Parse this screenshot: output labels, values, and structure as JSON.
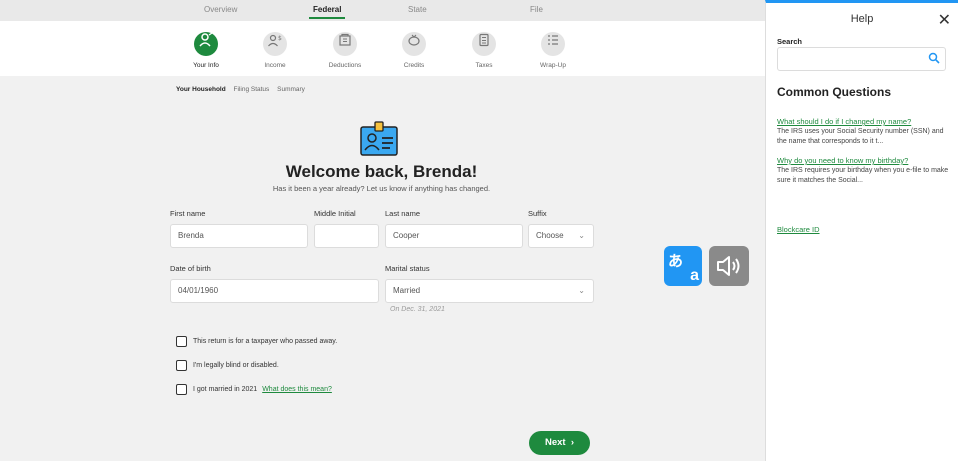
{
  "top_tabs": [
    {
      "label": "Overview"
    },
    {
      "label": "Federal"
    },
    {
      "label": "State"
    },
    {
      "label": "File"
    }
  ],
  "steps": [
    {
      "label": "Your Info",
      "icon": "person-icon"
    },
    {
      "label": "Income",
      "icon": "income-icon"
    },
    {
      "label": "Deductions",
      "icon": "deductions-icon"
    },
    {
      "label": "Credits",
      "icon": "piggy-bank-icon"
    },
    {
      "label": "Taxes",
      "icon": "calculator-icon"
    },
    {
      "label": "Wrap-Up",
      "icon": "checklist-icon"
    }
  ],
  "sub_nav": [
    "Your Household",
    "Filing Status",
    "Summary"
  ],
  "header": {
    "title": "Welcome back, Brenda!",
    "subtitle": "Has it been a year already? Let us know if anything has changed."
  },
  "form": {
    "first_name": {
      "label": "First name",
      "value": "Brenda"
    },
    "middle_initial": {
      "label": "Middle Initial",
      "value": ""
    },
    "last_name": {
      "label": "Last name",
      "value": "Cooper"
    },
    "suffix": {
      "label": "Suffix",
      "value": "Choose"
    },
    "dob": {
      "label": "Date of birth",
      "value": "04/01/1960"
    },
    "marital_status": {
      "label": "Marital status",
      "value": "Married",
      "note": "On Dec. 31, 2021"
    },
    "checkboxes": [
      {
        "label": "This return is for a taxpayer who passed away.",
        "checked": false
      },
      {
        "label": "I'm legally blind or disabled.",
        "checked": false
      },
      {
        "label": "I got married in 2021",
        "checked": false,
        "link": "What does this mean?"
      }
    ],
    "next_label": "Next"
  },
  "help": {
    "title": "Help",
    "close": "✕",
    "search_label": "Search",
    "search_placeholder": "",
    "heading": "Common Questions",
    "questions": [
      {
        "q": "What should I do if I changed my name?",
        "snippet": "The IRS uses your Social Security number (SSN) and the name that corresponds to it t..."
      },
      {
        "q": "Why do you need to know my birthday?",
        "snippet": "The IRS requires your birthday when you e-file to make sure it matches the Social..."
      }
    ],
    "blockcare": "Blockcare ID"
  },
  "tools": {
    "translate_ja": "あ",
    "translate_en": "a"
  },
  "colors": {
    "accent": "#1e8a3e",
    "help_accent": "#2196f3"
  }
}
